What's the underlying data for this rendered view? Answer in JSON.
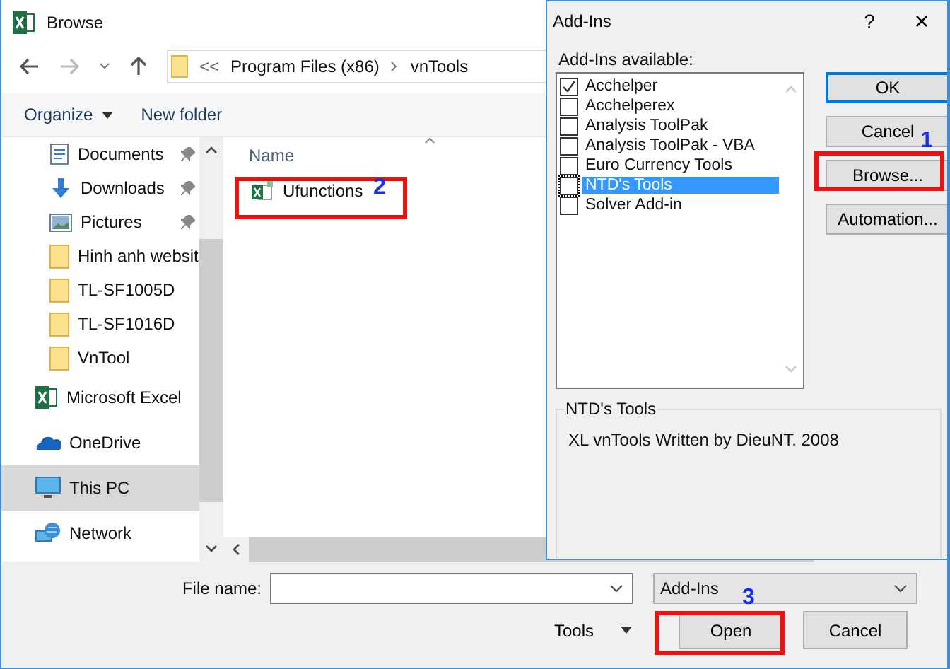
{
  "browse_window": {
    "title": "Browse",
    "breadcrumb": {
      "overflow": "<<",
      "path": [
        "Program Files (x86)",
        "vnTools"
      ]
    },
    "toolbar": {
      "organize": "Organize",
      "new_folder": "New folder"
    },
    "nav": {
      "quick_access": [
        {
          "kind": "documents",
          "label": "Documents",
          "pinned": true
        },
        {
          "kind": "downloads",
          "label": "Downloads",
          "pinned": true
        },
        {
          "kind": "pictures",
          "label": "Pictures",
          "pinned": true
        },
        {
          "kind": "folder",
          "label": "Hinh anh websit",
          "pinned": false
        },
        {
          "kind": "folder",
          "label": "TL-SF1005D",
          "pinned": false
        },
        {
          "kind": "folder",
          "label": "TL-SF1016D",
          "pinned": false
        },
        {
          "kind": "folder",
          "label": "VnTool",
          "pinned": false
        }
      ],
      "places": [
        {
          "kind": "excel",
          "label": "Microsoft Excel",
          "selected": false
        },
        {
          "kind": "onedrive",
          "label": "OneDrive",
          "selected": false
        },
        {
          "kind": "pc",
          "label": "This PC",
          "selected": true
        },
        {
          "kind": "network",
          "label": "Network",
          "selected": false
        }
      ]
    },
    "file_list": {
      "column": "Name",
      "files": [
        {
          "name": "Ufunctions"
        }
      ]
    },
    "file_name_label": "File name:",
    "file_type": "Add-Ins",
    "tools": "Tools",
    "buttons": [
      "Open",
      "Cancel"
    ]
  },
  "addins_window": {
    "title": "Add-Ins",
    "help": "?",
    "close": "×",
    "list_label": "Add-Ins available:",
    "addins": [
      {
        "label": "Acchelper",
        "checked": true,
        "selected": false
      },
      {
        "label": "Acchelperex",
        "checked": false,
        "selected": false
      },
      {
        "label": "Analysis ToolPak",
        "checked": false,
        "selected": false
      },
      {
        "label": "Analysis ToolPak - VBA",
        "checked": false,
        "selected": false
      },
      {
        "label": "Euro Currency Tools",
        "checked": false,
        "selected": false
      },
      {
        "label": "NTD's Tools",
        "checked": false,
        "selected": true
      },
      {
        "label": "Solver Add-in",
        "checked": false,
        "selected": false
      }
    ],
    "buttons": [
      "OK",
      "Cancel",
      "Browse...",
      "Automation..."
    ],
    "details": {
      "title": "NTD's Tools",
      "description": "XL vnTools Written by DieuNT. 2008"
    }
  },
  "annotations": [
    {
      "label": "1"
    },
    {
      "label": "2"
    },
    {
      "label": "3"
    }
  ]
}
